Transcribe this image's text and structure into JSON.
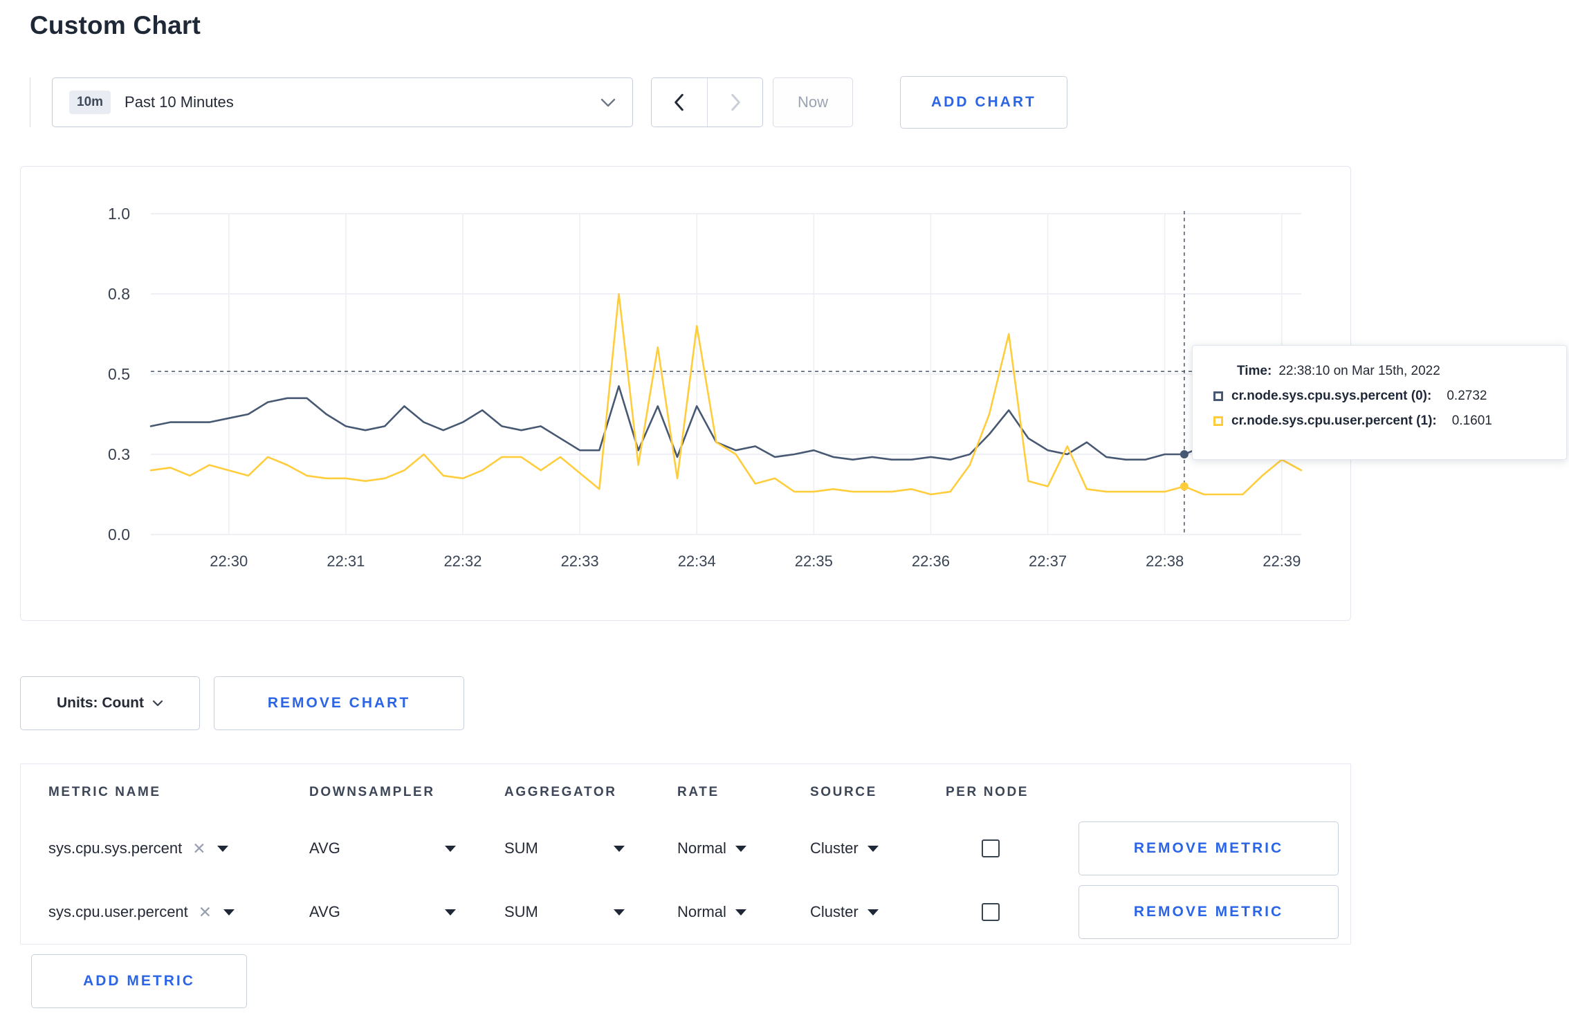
{
  "accent_color": "#2b65e6",
  "page": {
    "title": "Custom Chart"
  },
  "toolbar": {
    "time_badge": "10m",
    "time_range": "Past 10 Minutes",
    "now_label": "Now",
    "add_chart_label": "ADD CHART"
  },
  "chart_controls": {
    "units_label": "Units: Count",
    "remove_chart_label": "REMOVE CHART"
  },
  "chart_data": {
    "type": "line",
    "x_tick_labels": [
      "22:30",
      "22:31",
      "22:32",
      "22:33",
      "22:34",
      "22:35",
      "22:36",
      "22:37",
      "22:38",
      "22:39"
    ],
    "first_tick_offset_seconds": 40,
    "tick_interval_seconds": 60,
    "point_interval_seconds": 10,
    "y_ticks": [
      0.0,
      0.3,
      0.5,
      0.8,
      1.0
    ],
    "ylim": [
      0,
      1.0
    ],
    "grid": true,
    "series": [
      {
        "name": "cr.node.sys.cpu.sys.percent",
        "color": "#475872",
        "values": [
          0.37,
          0.38,
          0.38,
          0.38,
          0.39,
          0.4,
          0.43,
          0.44,
          0.44,
          0.4,
          0.37,
          0.36,
          0.37,
          0.42,
          0.38,
          0.36,
          0.38,
          0.41,
          0.37,
          0.36,
          0.37,
          0.34,
          0.31,
          0.31,
          0.47,
          0.31,
          0.42,
          0.29,
          0.42,
          0.33,
          0.31,
          0.32,
          0.29,
          0.3,
          0.31,
          0.29,
          0.28,
          0.29,
          0.28,
          0.28,
          0.29,
          0.28,
          0.3,
          0.35,
          0.41,
          0.34,
          0.31,
          0.3,
          0.33,
          0.29,
          0.28,
          0.28,
          0.3,
          0.3,
          0.32,
          0.3,
          0.3,
          0.31,
          0.3,
          0.3
        ]
      },
      {
        "name": "cr.node.sys.cpu.user.percent",
        "color": "#ffcd3c",
        "values": [
          0.24,
          0.25,
          0.22,
          0.26,
          0.24,
          0.22,
          0.29,
          0.26,
          0.22,
          0.21,
          0.21,
          0.2,
          0.21,
          0.24,
          0.3,
          0.22,
          0.21,
          0.24,
          0.29,
          0.29,
          0.24,
          0.29,
          0.23,
          0.17,
          0.8,
          0.26,
          0.6,
          0.21,
          0.68,
          0.33,
          0.3,
          0.19,
          0.21,
          0.16,
          0.16,
          0.17,
          0.16,
          0.16,
          0.16,
          0.17,
          0.15,
          0.16,
          0.26,
          0.4,
          0.65,
          0.2,
          0.18,
          0.32,
          0.17,
          0.16,
          0.16,
          0.16,
          0.16,
          0.18,
          0.15,
          0.15,
          0.15,
          0.22,
          0.28,
          0.24
        ]
      }
    ],
    "crosshair": {
      "point_index": 53,
      "hline_value": 0.51,
      "color": "#4a5568"
    }
  },
  "tooltip": {
    "time_label": "Time:",
    "time_value": "22:38:10 on Mar 15th, 2022",
    "rows": [
      {
        "label": "cr.node.sys.cpu.sys.percent (0):",
        "value": "0.2732",
        "color": "#475872"
      },
      {
        "label": "cr.node.sys.cpu.user.percent (1):",
        "value": "0.1601",
        "color": "#ffcd3c"
      }
    ]
  },
  "metrics_table": {
    "headers": [
      "METRIC NAME",
      "DOWNSAMPLER",
      "AGGREGATOR",
      "RATE",
      "SOURCE",
      "PER NODE"
    ],
    "rows": [
      {
        "metric": "sys.cpu.sys.percent",
        "downsampler": "AVG",
        "aggregator": "SUM",
        "rate": "Normal",
        "source": "Cluster",
        "per_node": false
      },
      {
        "metric": "sys.cpu.user.percent",
        "downsampler": "AVG",
        "aggregator": "SUM",
        "rate": "Normal",
        "source": "Cluster",
        "per_node": false
      }
    ],
    "remove_metric_label": "REMOVE METRIC",
    "add_metric_label": "ADD METRIC"
  },
  "icons": {
    "remove_x": "✕",
    "chevron_down": "chevron-down",
    "chevron_left": "chevron-left",
    "chevron_right": "chevron-right",
    "caret_down": "caret-down"
  }
}
